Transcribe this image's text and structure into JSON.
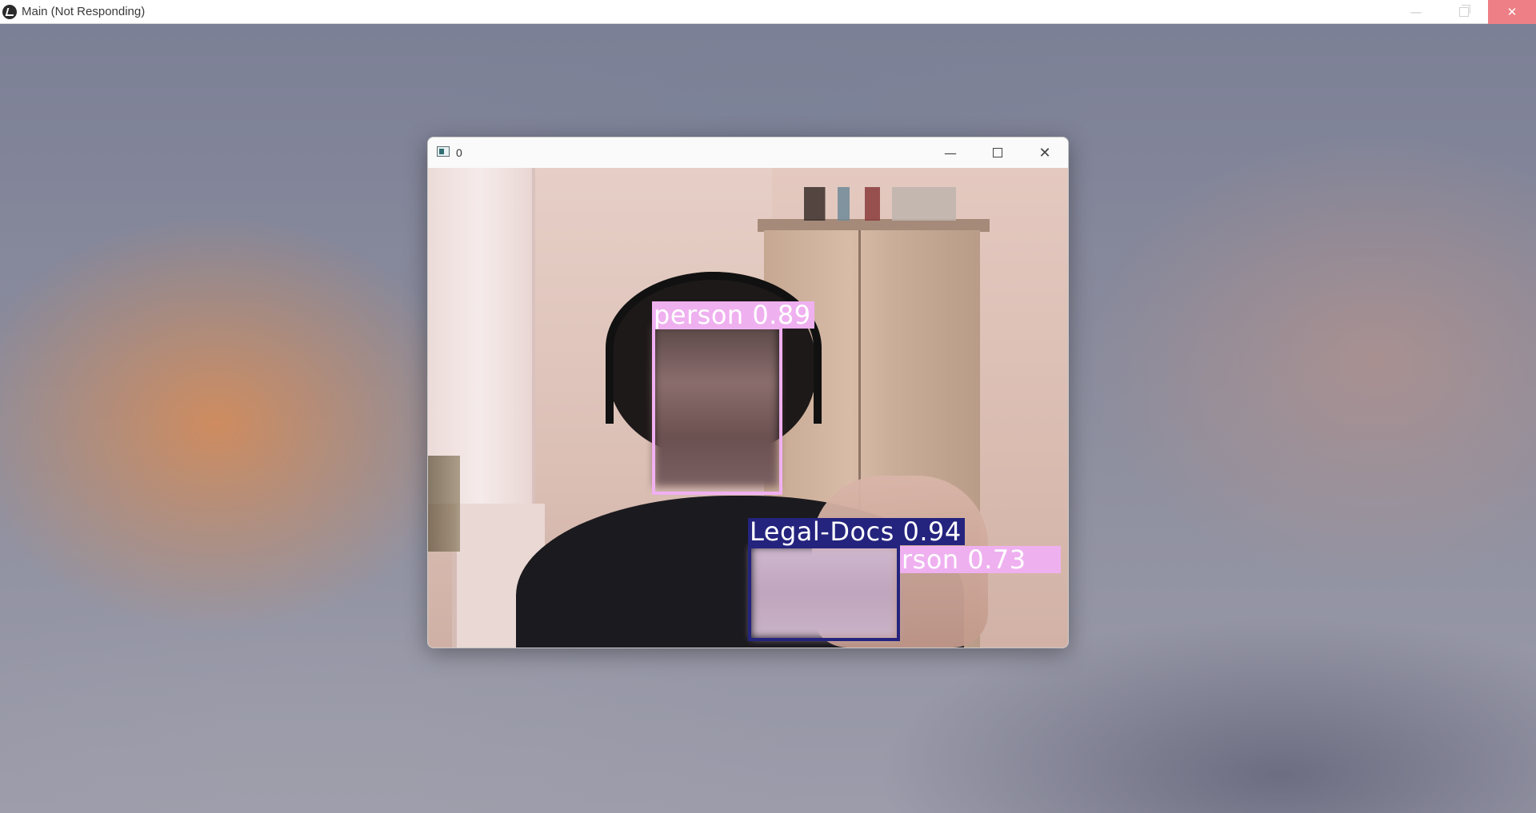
{
  "main_window": {
    "title": "Main (Not Responding)",
    "controls": {
      "minimize": "—",
      "restore": "restore",
      "close": "✕"
    }
  },
  "camera_window": {
    "title": "0",
    "controls": {
      "minimize": "—",
      "maximize": "maximize",
      "close": "✕"
    },
    "detections": [
      {
        "label": "person 0.89",
        "color": "#f0b0f2"
      },
      {
        "label": "Legal-Docs 0.94",
        "color": "#24237e"
      },
      {
        "label": "rson 0.73",
        "color": "#f0b0f2"
      }
    ]
  },
  "colors": {
    "person_box": "#f0b0f2",
    "docs_box": "#24237e",
    "close_hover": "#ee7f86"
  }
}
